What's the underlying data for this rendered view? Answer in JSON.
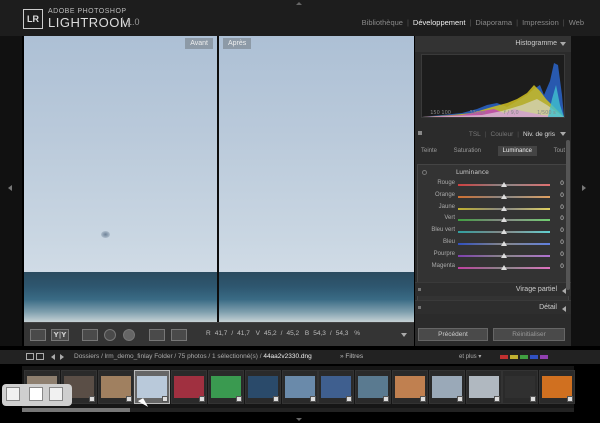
{
  "app": {
    "logo_text": "LR",
    "brand_line1": "ADOBE PHOTOSHOP",
    "brand_line2": "LIGHTROOM",
    "version": "1.0"
  },
  "modules": [
    {
      "label": "Bibliothèque",
      "active": false
    },
    {
      "label": "Développement",
      "active": true
    },
    {
      "label": "Diaporama",
      "active": false
    },
    {
      "label": "Impression",
      "active": false
    },
    {
      "label": "Web",
      "active": false
    }
  ],
  "images": {
    "before_label": "Avant",
    "after_label": "Après"
  },
  "toolbar": {
    "view_yy_label": "Y|Y",
    "readout": {
      "r_label": "R",
      "r_before": "41,7",
      "r_after": "41,7",
      "v_label": "V",
      "v_before": "45,2",
      "v_after": "45,2",
      "b_label": "B",
      "b_before": "54,3",
      "b_after": "54,3",
      "unit": "%"
    }
  },
  "right_panel": {
    "histogram_title": "Histogramme",
    "histogram_info": [
      "150 100",
      "33mm",
      "f / 9,0",
      "1/500 s"
    ],
    "hsl_tabs": [
      {
        "label": "TSL",
        "active": false
      },
      {
        "label": "Couleur",
        "active": false
      },
      {
        "label": "Niv. de gris",
        "active": true
      }
    ],
    "subtabs": [
      {
        "label": "Teinte",
        "active": false
      },
      {
        "label": "Saturation",
        "active": false
      },
      {
        "label": "Luminance",
        "active": true
      },
      {
        "label": "Tout",
        "active": false
      }
    ],
    "luminance_title": "Luminance",
    "luminance_rows": [
      {
        "label": "Rouge",
        "value": "0",
        "color_from": "#d04040",
        "color_to": "#e07070"
      },
      {
        "label": "Orange",
        "value": "0",
        "color_from": "#d07030",
        "color_to": "#e0a060"
      },
      {
        "label": "Jaune",
        "value": "0",
        "color_from": "#c0b030",
        "color_to": "#e0d060"
      },
      {
        "label": "Vert",
        "value": "0",
        "color_from": "#40a040",
        "color_to": "#70d070"
      },
      {
        "label": "Bleu vert",
        "value": "0",
        "color_from": "#30a0a0",
        "color_to": "#60d0d0"
      },
      {
        "label": "Bleu",
        "value": "0",
        "color_from": "#3050c0",
        "color_to": "#6080e0"
      },
      {
        "label": "Pourpre",
        "value": "0",
        "color_from": "#8040b0",
        "color_to": "#b070d0"
      },
      {
        "label": "Magenta",
        "value": "0",
        "color_from": "#c040a0",
        "color_to": "#e070c0"
      }
    ],
    "panel_virage": "Virage partiel",
    "panel_detail": "Détail",
    "btn_prev": "Précédent",
    "btn_reset": "Réinitialiser"
  },
  "filmstrip": {
    "path_prefix": "Dossiers / lrm_demo_finlay Folder / 75 photos / 1 sélectionné(s) /",
    "filename": "44aa2v2330.dng",
    "filter_label": "Filtres",
    "more_label": "et plus",
    "flag_colors": [
      "#c03030",
      "#c0b030",
      "#40a040",
      "#3050c0",
      "#9040b0"
    ],
    "thumbnails": [
      {
        "color": "#8e7f6f",
        "selected": false
      },
      {
        "color": "#5a4e46",
        "selected": false
      },
      {
        "color": "#a08060",
        "selected": false
      },
      {
        "color": "#b9c9da",
        "selected": true
      },
      {
        "color": "#a03040",
        "selected": false
      },
      {
        "color": "#3a9a50",
        "selected": false
      },
      {
        "color": "#2a4a6a",
        "selected": false
      },
      {
        "color": "#6a8aaa",
        "selected": false
      },
      {
        "color": "#3f5f8f",
        "selected": false
      },
      {
        "color": "#5a7a90",
        "selected": false
      },
      {
        "color": "#c08050",
        "selected": false
      },
      {
        "color": "#9aa9b8",
        "selected": false
      },
      {
        "color": "#b0b8c0",
        "selected": false
      },
      {
        "color": "#303030",
        "selected": false
      },
      {
        "color": "#d07020",
        "selected": false
      }
    ]
  }
}
